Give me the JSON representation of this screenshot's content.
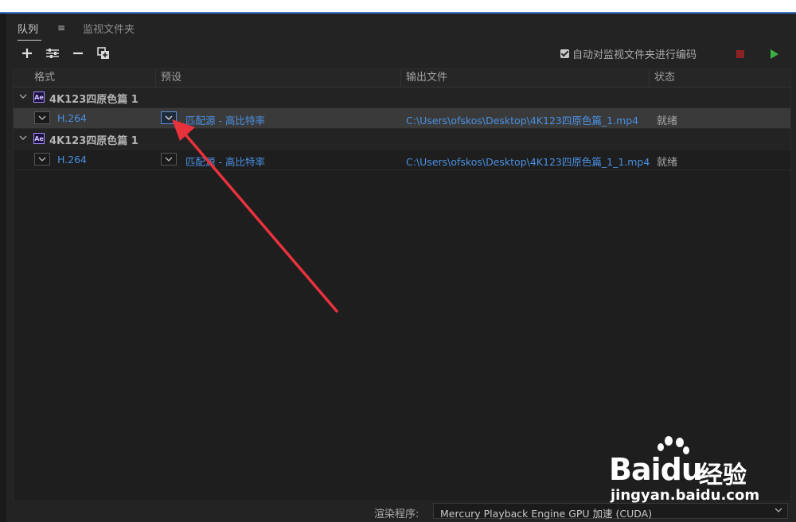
{
  "tabs": [
    {
      "label": "队列",
      "active": true
    },
    {
      "label": "监视文件夹",
      "active": false
    }
  ],
  "toolbar": {
    "icons": [
      "add-icon",
      "settings-icon",
      "remove-icon",
      "duplicate-icon"
    ]
  },
  "auto_encode": {
    "label": "自动对监视文件夹进行编码",
    "checked": true
  },
  "colors": {
    "stop": "#8b2323",
    "play": "#3cb043",
    "link": "#4a90e2",
    "arrow": "#e8323c"
  },
  "columns": [
    "格式",
    "预设",
    "输出文件",
    "状态"
  ],
  "groups": [
    {
      "name": "4K123四原色篇 1",
      "app_icon": "Ae",
      "item": {
        "format": "H.264",
        "preset": "匹配源 - 高比特率",
        "output": "C:\\Users\\ofskos\\Desktop\\4K123四原色篇_1.mp4",
        "status": "就绪",
        "selected": true
      }
    },
    {
      "name": "4K123四原色篇 1",
      "app_icon": "Ae",
      "item": {
        "format": "H.264",
        "preset": "匹配源 - 高比特率",
        "output": "C:\\Users\\ofskos\\Desktop\\4K123四原色篇_1_1.mp4",
        "status": "就绪",
        "selected": false
      }
    }
  ],
  "renderer": {
    "label": "渲染程序:",
    "value": "Mercury Playback Engine GPU 加速 (CUDA)"
  },
  "watermark": {
    "logo": "Bai",
    "logo2": "du",
    "cn": "经验",
    "url": "jingyan.baidu.com"
  }
}
